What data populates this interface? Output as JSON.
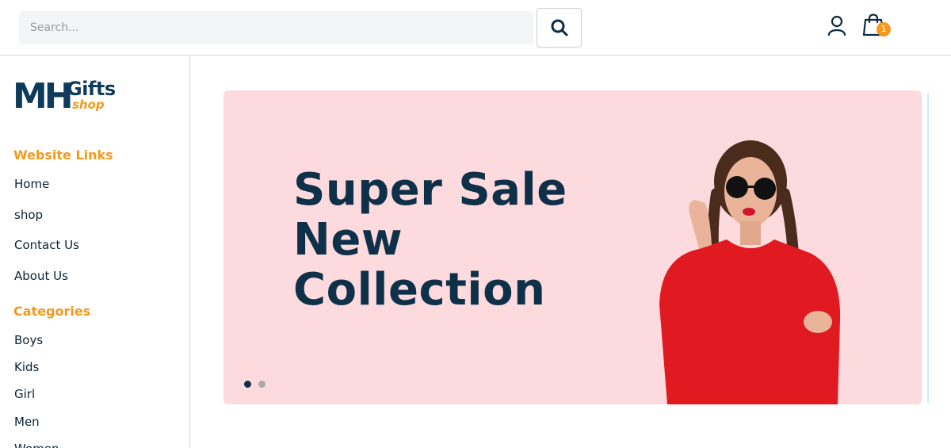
{
  "header": {
    "search_placeholder": "Search...",
    "cart_count": "1",
    "icons": {
      "search": "search-icon",
      "user": "user-icon",
      "cart": "shopping-bag-icon"
    },
    "badge_color": "#f39a1c"
  },
  "sidebar": {
    "logo": {
      "mh": "MH",
      "gifts": "Gifts",
      "shop": "shop"
    },
    "website_links_title": "Website Links",
    "website_links": [
      "Home",
      "shop",
      "Contact Us",
      "About Us"
    ],
    "categories_title": "Categories",
    "categories": [
      "Boys",
      "Kids",
      "Girl",
      "Men",
      "Women"
    ]
  },
  "hero": {
    "headline_lines": [
      "Super Sale",
      "New",
      "Collection"
    ],
    "slide_count": 2,
    "active_slide": 1,
    "background_color": "#fddadd",
    "headline_color": "#0e3048"
  },
  "colors": {
    "accent": "#f39a1c",
    "brand": "#0e3a5b"
  }
}
